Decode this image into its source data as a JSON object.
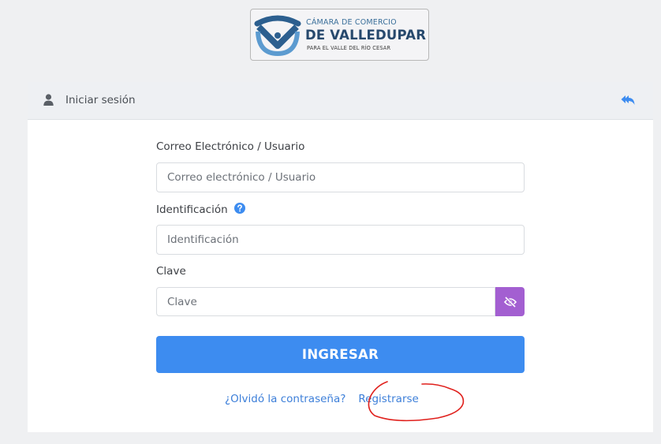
{
  "logo": {
    "line1": "CÁMARA DE COMERCIO",
    "line2": "DE VALLEDUPAR",
    "line3": "PARA EL VALLE DEL RÍO CESAR"
  },
  "header": {
    "title": "Iniciar sesión",
    "user_icon": "user-icon",
    "back_icon": "reply-all-icon"
  },
  "form": {
    "email_label": "Correo Electrónico / Usuario",
    "email_placeholder": "Correo electrónico / Usuario",
    "id_label": "Identificación",
    "id_placeholder": "Identificación",
    "help_icon": "question-circle-icon",
    "password_label": "Clave",
    "password_placeholder": "Clave",
    "eye_icon": "eye-slash-icon",
    "submit_label": "INGRESAR"
  },
  "links": {
    "forgot": "¿Olvidó la contraseña?",
    "register": "Registrarse"
  },
  "colors": {
    "primary": "#3d8cf0",
    "eye_button": "#a35fd1",
    "link": "#3d7fd9",
    "annotation": "#e0201c"
  }
}
